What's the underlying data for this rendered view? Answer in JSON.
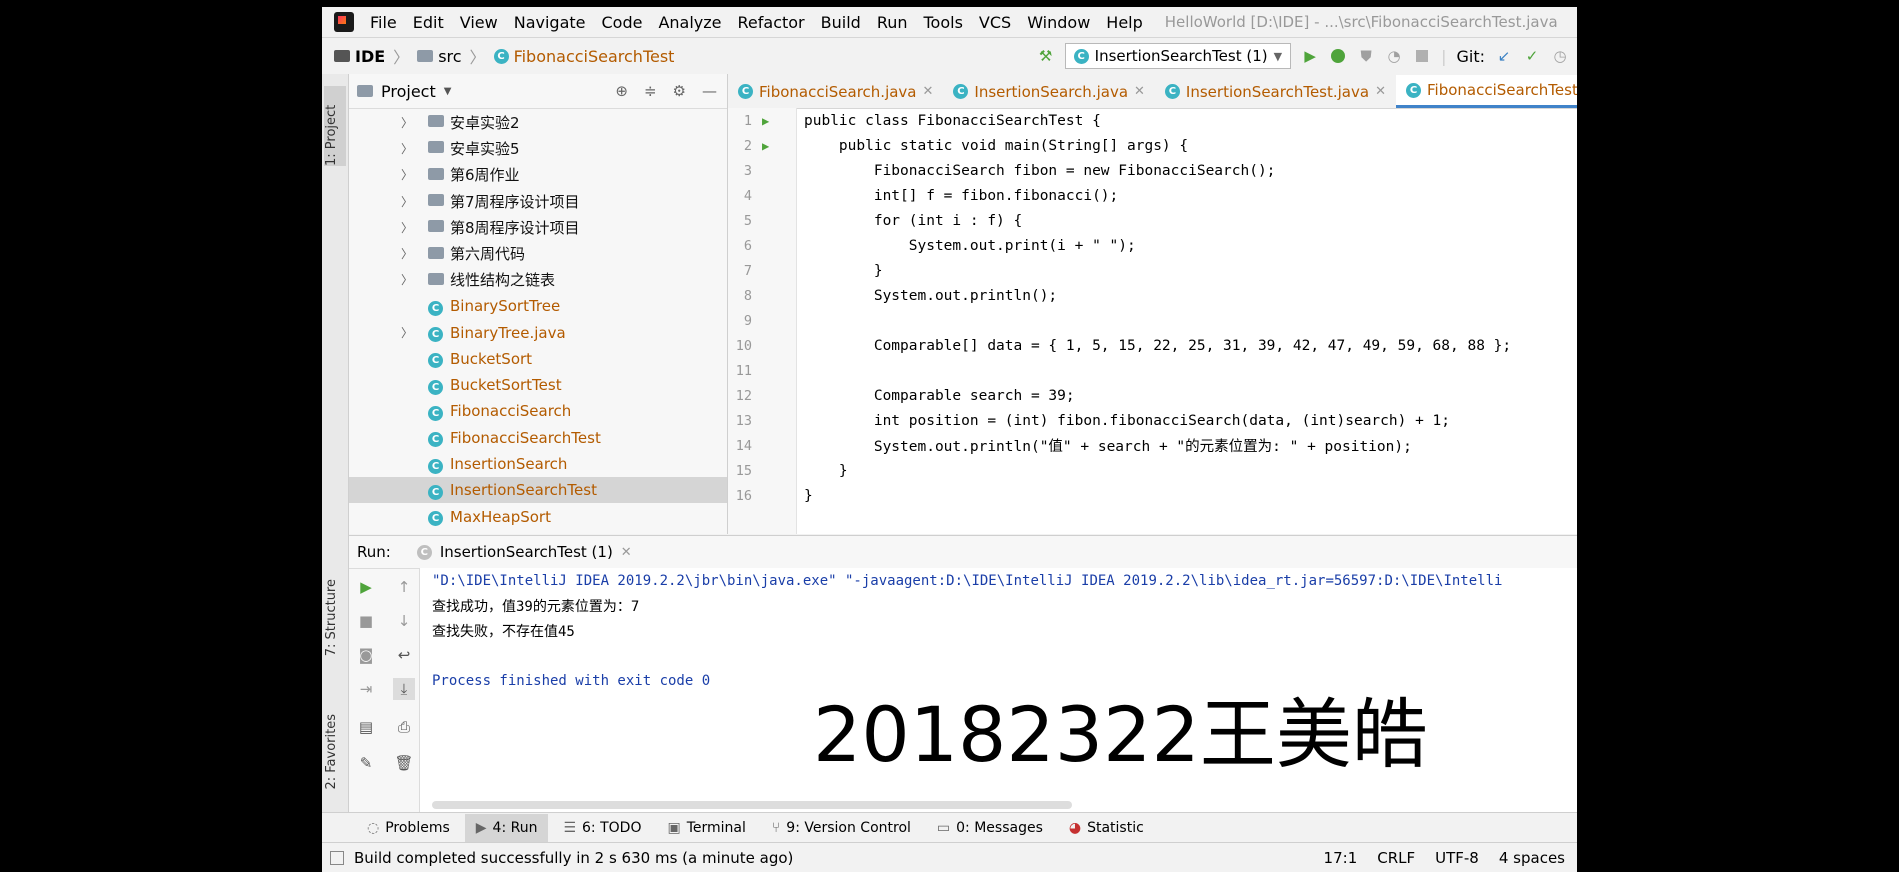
{
  "menu": [
    "File",
    "Edit",
    "View",
    "Navigate",
    "Code",
    "Analyze",
    "Refactor",
    "Build",
    "Run",
    "Tools",
    "VCS",
    "Window",
    "Help"
  ],
  "window_title": "HelloWorld [D:\\IDE] - ...\\src\\FibonacciSearchTest.java",
  "breadcrumb": {
    "project": "IDE",
    "folder": "src",
    "file": "FibonacciSearchTest"
  },
  "run_config": "InsertionSearchTest (1)",
  "git_label": "Git:",
  "left_strip": {
    "project_tab": "1: Project",
    "structure_tab": "7: Structure",
    "favorites_tab": "2: Favorites"
  },
  "project_panel": {
    "title": "Project",
    "items": [
      {
        "label": "安卓实验2",
        "type": "dir"
      },
      {
        "label": "安卓实验5",
        "type": "dir"
      },
      {
        "label": "第6周作业",
        "type": "dir"
      },
      {
        "label": "第7周程序设计项目",
        "type": "dir"
      },
      {
        "label": "第8周程序设计项目",
        "type": "dir"
      },
      {
        "label": "第六周代码",
        "type": "dir"
      },
      {
        "label": "线性结构之链表",
        "type": "dir"
      },
      {
        "label": "BinarySortTree",
        "type": "class"
      },
      {
        "label": "BinaryTree.java",
        "type": "class-expand"
      },
      {
        "label": "BucketSort",
        "type": "class"
      },
      {
        "label": "BucketSortTest",
        "type": "class"
      },
      {
        "label": "FibonacciSearch",
        "type": "class"
      },
      {
        "label": "FibonacciSearchTest",
        "type": "class"
      },
      {
        "label": "InsertionSearch",
        "type": "class"
      },
      {
        "label": "InsertionSearchTest",
        "type": "class-selected"
      },
      {
        "label": "MaxHeapSort",
        "type": "class"
      }
    ]
  },
  "editor_tabs": [
    {
      "label": "FibonacciSearch.java",
      "active": false
    },
    {
      "label": "InsertionSearch.java",
      "active": false
    },
    {
      "label": "InsertionSearchTest.java",
      "active": false
    },
    {
      "label": "FibonacciSearchTest.java",
      "active": true
    }
  ],
  "code_lines": [
    {
      "n": "1",
      "text": "public class FibonacciSearchTest {"
    },
    {
      "n": "2",
      "text": "    public static void main(String[] args) {"
    },
    {
      "n": "3",
      "text": "        FibonacciSearch fibon = new FibonacciSearch();"
    },
    {
      "n": "4",
      "text": "        int[] f = fibon.fibonacci();"
    },
    {
      "n": "5",
      "text": "        for (int i : f) {"
    },
    {
      "n": "6",
      "text": "            System.out.print(i + \" \");"
    },
    {
      "n": "7",
      "text": "        }"
    },
    {
      "n": "8",
      "text": "        System.out.println();"
    },
    {
      "n": "9",
      "text": ""
    },
    {
      "n": "10",
      "text": "        Comparable[] data = { 1, 5, 15, 22, 25, 31, 39, 42, 47, 49, 59, 68, 88 };"
    },
    {
      "n": "11",
      "text": ""
    },
    {
      "n": "12",
      "text": "        Comparable search = 39;"
    },
    {
      "n": "13",
      "text": "        int position = (int) fibon.fibonacciSearch(data, (int)search) + 1;"
    },
    {
      "n": "14",
      "text": "        System.out.println(\"值\" + search + \"的元素位置为: \" + position);"
    },
    {
      "n": "15",
      "text": "    }"
    },
    {
      "n": "16",
      "text": "}"
    }
  ],
  "run_panel": {
    "title": "Run:",
    "tab": "InsertionSearchTest (1)",
    "console": [
      "\"D:\\IDE\\IntelliJ IDEA 2019.2.2\\jbr\\bin\\java.exe\" \"-javaagent:D:\\IDE\\IntelliJ IDEA 2019.2.2\\lib\\idea_rt.jar=56597:D:\\IDE\\Intelli",
      "查找成功，值39的元素位置为：7",
      "查找失败，不存在值45",
      "",
      "Process finished with exit code 0"
    ],
    "watermark": "20182322王美皓"
  },
  "tool_tabs": [
    "Problems",
    "4: Run",
    "6: TODO",
    "Terminal",
    "9: Version Control",
    "0: Messages",
    "Statistic"
  ],
  "status_bar": {
    "message": "Build completed successfully in 2 s 630 ms (a minute ago)",
    "position": "17:1",
    "line_sep": "CRLF",
    "encoding": "UTF-8",
    "indent": "4 spaces"
  }
}
